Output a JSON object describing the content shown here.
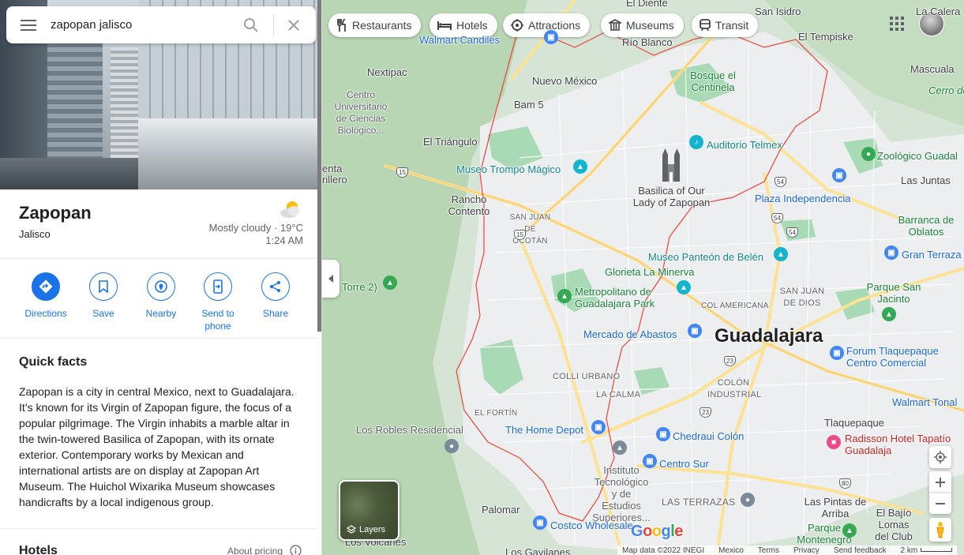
{
  "search": {
    "query": "zapopan jalisco"
  },
  "place": {
    "title": "Zapopan",
    "subtitle": "Jalisco",
    "weather_text": "Mostly cloudy · 19°C",
    "weather_time": "1:24 AM"
  },
  "actions": [
    {
      "label": "Directions",
      "icon": "directions-icon"
    },
    {
      "label": "Save",
      "icon": "bookmark-icon"
    },
    {
      "label": "Nearby",
      "icon": "nearby-icon"
    },
    {
      "label": "Send to phone",
      "icon": "phone-icon"
    },
    {
      "label": "Share",
      "icon": "share-icon"
    }
  ],
  "quick_facts": {
    "title": "Quick facts",
    "body": "Zapopan is a city in central Mexico, next to Guadalajara. It’s known for its Virgin of Zapopan figure, the focus of a popular pilgrimage. The Virgin inhabits a marble altar in the twin-towered Basilica of Zapopan, with its ornate exterior. Contemporary works by Mexican and international artists are on display at Zapopan Art Museum. The Huichol Wixarika Museum showcases handicrafts by a local indigenous group."
  },
  "hotels": {
    "title": "Hotels",
    "about_pricing": "About pricing"
  },
  "chips": [
    {
      "label": "Restaurants",
      "icon": "fork-knife-icon"
    },
    {
      "label": "Hotels",
      "icon": "bed-icon"
    },
    {
      "label": "Attractions",
      "icon": "attractions-icon"
    },
    {
      "label": "Museums",
      "icon": "museum-icon"
    },
    {
      "label": "Transit",
      "icon": "transit-icon"
    }
  ],
  "map_labels": {
    "el_diente": "El Diente",
    "san_isidro": "San Isidro",
    "la_cale": "La Calera",
    "walmart_candiles": "Walmart Candiles",
    "rio_blanco": "Río Blanco",
    "el_tempiske": "El Tempiske",
    "mascuala": "Mascuala",
    "cerro": "Cerro de",
    "nextipac": "Nextipac",
    "nuevo_mexico": "Nuevo México",
    "bosque": "Bosque el Centinela",
    "centro": "Centro Universitario de Ciencias Biológico...",
    "bam5": "Bam 5",
    "el_triangulo": "El Triángulo",
    "auditorio": "Auditorio Telmex",
    "zoologico": "Zoológico Guadal",
    "museo_trompo": "Museo Trompo Mágico",
    "entra": "enta",
    "rillero": "rillero",
    "basilica": "Basilica of Our Lady of Zapopan",
    "las_juntas": "Las Juntas",
    "plaza_indep": "Plaza Independencia",
    "rancho": "Rancho Contento",
    "san_juan_ocotan": "SAN JUAN DE OCOTÁN",
    "barranca": "Barranca de Oblatos",
    "museo_panteon": "Museo Panteón de Belén",
    "gran_terraza": "Gran Terraza",
    "glorieta": "Glorieta La Minerva",
    "torre2": "Torre 2)",
    "parque_san_jacinto": "Parque San Jacinto",
    "san_juan_dios": "SAN JUAN DE DIOS",
    "metropolitano": "Metropolitano de Guadalajara Park",
    "col_americana": "COL AMERICANA",
    "mercado": "Mercado de Abastos",
    "guadalajara": "Guadalajara",
    "forum": "Forum Tlaquepaque Centro Comercial",
    "colli": "COLLI URBANO",
    "colon": "COLÓN INDUSTRIAL",
    "la_calma": "LA CALMA",
    "walmart_tonala": "Walmart Tonal",
    "el_fortin": "EL FORTÍN",
    "tlaquepaque": "Tlaquepaque",
    "los_robles": "Los Robles Residencial",
    "home_depot": "The Home Depot",
    "chedraui": "Chedraui Colón",
    "radisson": "Radisson Hotel Tapatío Guadalaja",
    "instituto": "Instituto Tecnológico y de Estudios Superiores...",
    "centro_sur": "Centro Sur",
    "las_terrazas": "LAS TERRAZAS",
    "palomar": "Palomar",
    "las_pintas": "Las Pintas de Arriba",
    "el_bajio": "El Bajío Lomas del Club",
    "costco": "Costco Wholesale",
    "parque_montenegro": "Parque Montenegro",
    "volcanes": "Los Volcanes",
    "gavilanes": "Los Gavilanes"
  },
  "shields": [
    "15",
    "15",
    "54",
    "54",
    "54",
    "23",
    "23",
    "80"
  ],
  "layers": {
    "label": "Layers"
  },
  "footer": {
    "map_data": "Map data ©2022 INEGI",
    "region": "Mexico",
    "terms": "Terms",
    "privacy": "Privacy",
    "feedback": "Send feedback",
    "scale": "2 km"
  },
  "logo": "Google",
  "colors": {
    "accent": "#1a73e8",
    "boundary": "#ea4335",
    "park": "#a8dab5",
    "road": "#fde293"
  }
}
